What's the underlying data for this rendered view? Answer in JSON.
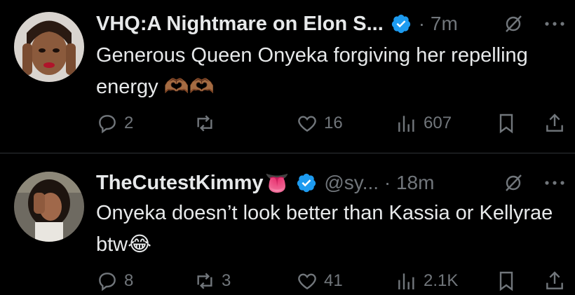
{
  "tweets": [
    {
      "name": "VHQ:A Nightmare on Elon S...",
      "meta": "· 7m",
      "text": "Generous Queen Onyeka forgiving her repelling energy",
      "emoji": "🫶🏾🫶🏾",
      "replies": "2",
      "reposts": "",
      "likes": "16",
      "views": "607"
    },
    {
      "name": "TheCutestKimmy",
      "name_emoji": "👅",
      "meta": "@sy... · 18m",
      "text": "Onyeka doesn’t look better than Kassia or Kellyrae btw",
      "emoji": "😂",
      "replies": "8",
      "reposts": "3",
      "likes": "41",
      "views": "2.1K"
    }
  ],
  "colors": {
    "background": "#000000",
    "text": "#e7e9ea",
    "muted": "#71767b",
    "verified": "#1d9bf0",
    "divider": "#2f3336"
  },
  "icons": [
    "reply-icon",
    "repost-icon",
    "like-icon",
    "views-icon",
    "bookmark-icon",
    "share-icon",
    "grok-icon",
    "more-icon",
    "verified-badge-icon"
  ]
}
